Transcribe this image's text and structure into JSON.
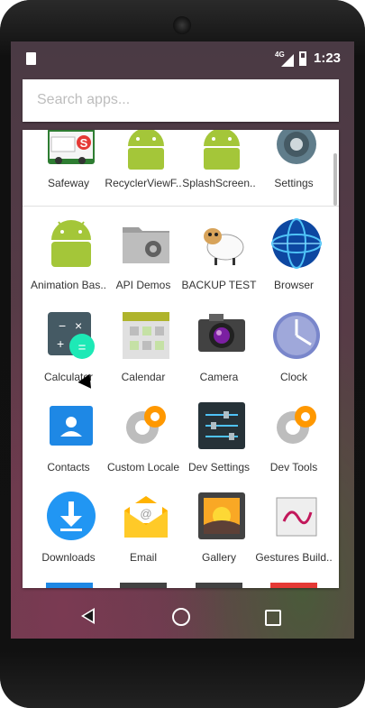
{
  "status": {
    "time": "1:23",
    "network": "4G"
  },
  "search": {
    "placeholder": "Search apps..."
  },
  "apps_top": [
    {
      "label": "Safeway"
    },
    {
      "label": "RecyclerViewF.."
    },
    {
      "label": "SplashScreen.."
    },
    {
      "label": "Settings"
    }
  ],
  "apps": [
    {
      "label": "Animation Bas.."
    },
    {
      "label": "API Demos"
    },
    {
      "label": "BACKUP TEST"
    },
    {
      "label": "Browser"
    },
    {
      "label": "Calculator"
    },
    {
      "label": "Calendar"
    },
    {
      "label": "Camera"
    },
    {
      "label": "Clock"
    },
    {
      "label": "Contacts"
    },
    {
      "label": "Custom Locale"
    },
    {
      "label": "Dev Settings"
    },
    {
      "label": "Dev Tools"
    },
    {
      "label": "Downloads"
    },
    {
      "label": "Email"
    },
    {
      "label": "Gallery"
    },
    {
      "label": "Gestures Build.."
    }
  ],
  "colors": {
    "panel": "#ffffff",
    "accent_blue": "#2196f3",
    "android_green": "#a4c639"
  }
}
